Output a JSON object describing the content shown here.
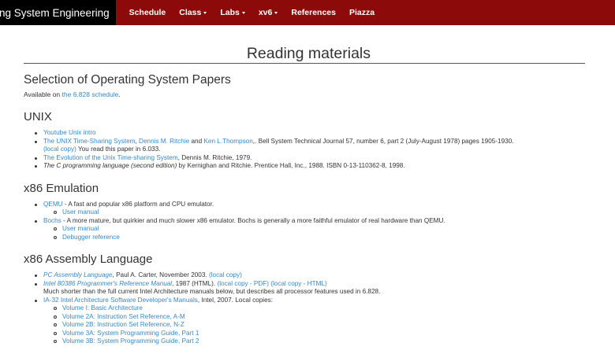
{
  "nav": {
    "brand": "ing System Engineering",
    "items": [
      {
        "label": "Schedule",
        "dropdown": false
      },
      {
        "label": "Class",
        "dropdown": true
      },
      {
        "label": "Labs",
        "dropdown": true
      },
      {
        "label": "xv6",
        "dropdown": true
      },
      {
        "label": "References",
        "dropdown": false
      },
      {
        "label": "Piazza",
        "dropdown": false
      }
    ]
  },
  "colors": {
    "navbar": "#8c0a0a",
    "brand_bg": "#000000",
    "link": "#3a87c5"
  },
  "page_title": "Reading materials",
  "papers": {
    "title": "Selection of Operating System Papers",
    "lead_prefix": "Available on ",
    "lead_link": "the 6.828 schedule",
    "lead_suffix": "."
  },
  "unix": {
    "title": "UNIX",
    "item1_link": "Youtube Unix intro",
    "item2_link1": "The UNIX Time-Sharing System",
    "item2_sep1": ", ",
    "item2_link2": "Dennis M. Ritchie",
    "item2_sep2": " and ",
    "item2_link3": "Ken L.Thompson",
    "item2_text": ",. Bell System Technical Journal 57, number 6, part 2 (July-August 1978) pages 1905-1930.",
    "item2_link4": "(local copy)",
    "item2_text2": " You read this paper in 6.033.",
    "item3_link": "The Evolution of the Unix Time-sharing System",
    "item3_text": ", Dennis M. Ritchie, 1979.",
    "item4_em": "The C programming language (second edition)",
    "item4_text": " by Kernighan and Ritchie. Prentice Hall, Inc., 1988. ISBN 0-13-110362-8, 1998."
  },
  "emulation": {
    "title": "x86 Emulation",
    "qemu_link": "QEMU",
    "qemu_text": " - A fast and popular x86 platform and CPU emulator.",
    "qemu_sub1": "User manual",
    "bochs_link": "Bochs",
    "bochs_text": " - A more mature, but quirkier and much slower x86 emulator. Bochs is generally a more faithful emulator of real hardware than QEMU.",
    "bochs_sub1": "User manual",
    "bochs_sub2": "Debugger reference"
  },
  "assembly": {
    "title": "x86 Assembly Language",
    "pc_link": "PC Assembly Language",
    "pc_text": ", Paul A. Carter, November 2003. ",
    "pc_local": "(local copy)",
    "i386_link": "Intel 80386 Programmer's Reference Manual",
    "i386_text": ", 1987 (HTML). ",
    "i386_pdf": "(local copy - PDF)",
    "i386_sep": " ",
    "i386_html": "(local copy - HTML)",
    "i386_note": "Much shorter than the full current Intel Architecture manuals below, but describes all processor features used in 6.828.",
    "ia32_link": "IA-32 Intel Architecture Software Developer's Manuals",
    "ia32_text": ", Intel, 2007. Local copies:",
    "volumes": [
      "Volume I: Basic Architecture",
      "Volume 2A: Instruction Set Reference, A-M",
      "Volume 2B: Instruction Set Reference, N-Z",
      "Volume 3A: System Programming Guide, Part 1",
      "Volume 3B: System Programming Guide, Part 2"
    ]
  }
}
